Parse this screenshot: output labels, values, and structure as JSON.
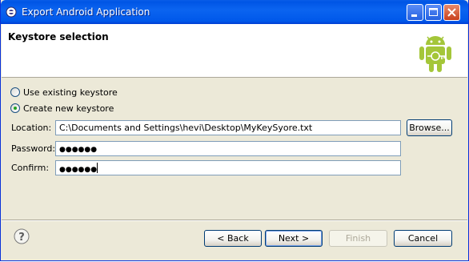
{
  "window": {
    "title": "Export Android Application",
    "controls": [
      "minimize",
      "maximize",
      "close"
    ]
  },
  "header": {
    "title": "Keystore selection",
    "logo_icon": "android-robot-icon"
  },
  "keystore": {
    "use_existing_label": "Use existing keystore",
    "create_new_label": "Create new keystore",
    "selected": "create_new"
  },
  "form": {
    "location_label": "Location:",
    "location_value": "C:\\Documents and Settings\\hevi\\Desktop\\MyKeySyore.txt",
    "browse_label": "Browse...",
    "password_label": "Password:",
    "password_value": "●●●●●●",
    "confirm_label": "Confirm:",
    "confirm_value": "●●●●●●"
  },
  "footer": {
    "help_icon": "help-icon",
    "back_label": "< Back",
    "next_label": "Next >",
    "finish_label": "Finish",
    "cancel_label": "Cancel"
  },
  "colors": {
    "titlebar": "#0058ea",
    "android_green": "#a4c639",
    "dialog_bg": "#ece9d8"
  }
}
